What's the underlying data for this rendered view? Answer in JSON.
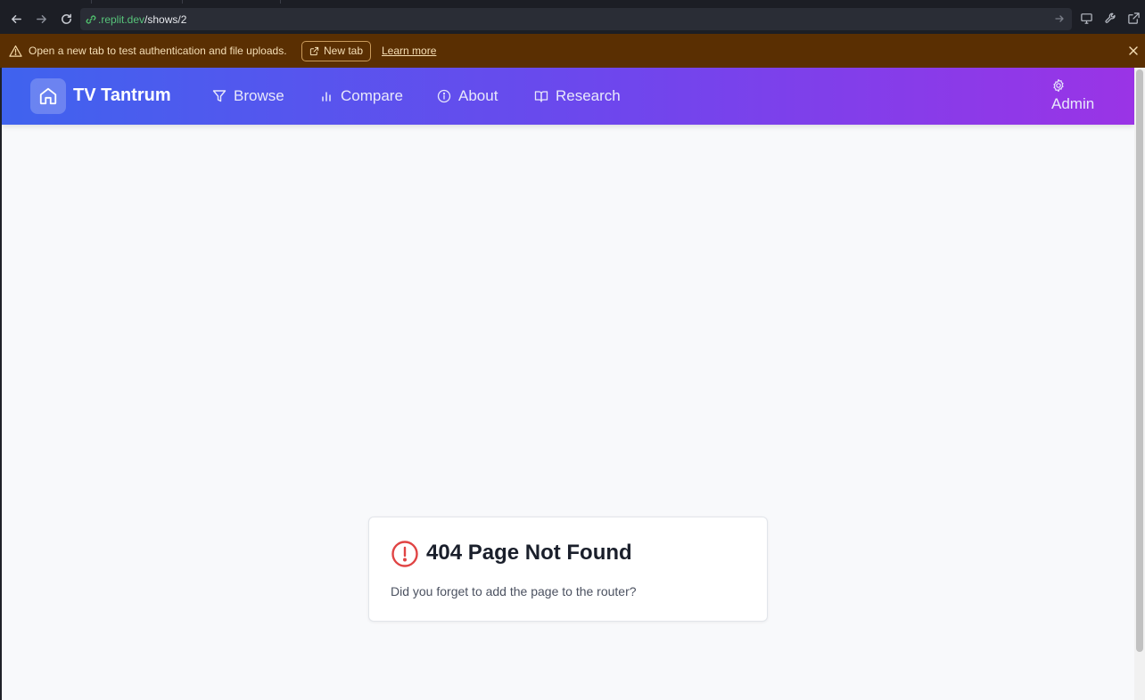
{
  "browser": {
    "url_host": ".replit.dev",
    "url_path": "/shows/2"
  },
  "banner": {
    "message": "Open a new tab to test authentication and file uploads.",
    "new_tab_label": "New tab",
    "learn_more_label": "Learn more",
    "background": "#5a2f02"
  },
  "header": {
    "brand": "TV Tantrum",
    "nav": [
      {
        "label": "Browse",
        "icon": "filter-icon"
      },
      {
        "label": "Compare",
        "icon": "bar-chart-icon"
      },
      {
        "label": "About",
        "icon": "info-icon"
      },
      {
        "label": "Research",
        "icon": "book-open-icon"
      }
    ],
    "admin_label": "Admin",
    "gradient": [
      "#3f63ee",
      "#6f46ed",
      "#9a34e6"
    ]
  },
  "error_card": {
    "title": "404 Page Not Found",
    "message": "Did you forget to add the page to the router?",
    "icon_color": "#e04444"
  }
}
